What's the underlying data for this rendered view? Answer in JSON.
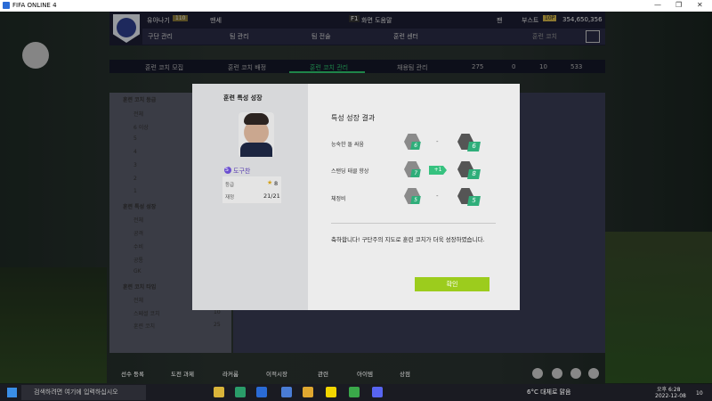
{
  "window": {
    "title": "FIFA ONLINE 4",
    "controls": [
      "—",
      "❐",
      "✕"
    ]
  },
  "topbar": {
    "club_name": "유아나기",
    "ovr": "110",
    "opponent": "맨세",
    "help_key": "F1",
    "help_label": "화면 도움말",
    "right_label_1": "팬",
    "right_label_2": "부스트",
    "boost_badge": "10P",
    "currency": "354,650,356",
    "nav": [
      "구단 관리",
      "팀 관리",
      "팀 전술",
      "훈련 센터",
      "훈련 코치"
    ]
  },
  "subnav": {
    "tabs": [
      "훈련 코치 모집",
      "훈련 코치 배정",
      "훈련 코치 관리",
      "채용팀 관리"
    ],
    "active_index": 2,
    "counts": [
      "275",
      "0",
      "10",
      "533"
    ]
  },
  "left_panel": {
    "grade_title": "훈련 코치 등급",
    "grade_items": [
      "전체",
      "6 이상",
      "5",
      "4",
      "3",
      "2",
      "1"
    ],
    "growth_title": "훈련 특성 성장",
    "growth_items": [
      "전체",
      "공격",
      "수비",
      "공통",
      "GK"
    ],
    "type_title": "훈련 코치 타입",
    "type_items": [
      "전체",
      "스페셜 코치",
      "훈련 코치"
    ],
    "type_counts": [
      "",
      "10",
      "25"
    ]
  },
  "modal": {
    "left_title": "훈련 특성 성장",
    "player_name": "도구찬",
    "player_badge": "S",
    "grade_label": "등급",
    "grade_value": "8",
    "role_label": "재정",
    "role_value": "21/21",
    "result_title": "특성 성장 결과",
    "rows": [
      {
        "label": "능숙한 돌 싸움",
        "before": "6",
        "after": "6",
        "changed": false
      },
      {
        "label": "스탠딩 태클 향상",
        "before": "7",
        "after": "8",
        "changed": true,
        "arrow_label": "+1"
      },
      {
        "label": "체정비",
        "before": "5",
        "after": "5",
        "changed": false
      }
    ],
    "message": "축하합니다! 구단주의 지도로 훈련 코치가 더욱 성장하였습니다.",
    "ok_label": "확인"
  },
  "bottom_menu": [
    "선수 등록",
    "도전 과제",
    "라커룸",
    "이적시장",
    "관련",
    "아이템",
    "상점"
  ],
  "taskbar": {
    "search_placeholder": "검색하려면 여기에 입력하십시오",
    "weather": "6°C  대체로 맑음",
    "time": "오후 6:28",
    "date": "2022-12-08",
    "notif": "10"
  },
  "colors": {
    "accent_green": "#2ecc71",
    "ok_button": "#9ccc1d",
    "badge_green": "#2fae7a",
    "purple": "#6b4fd0"
  }
}
